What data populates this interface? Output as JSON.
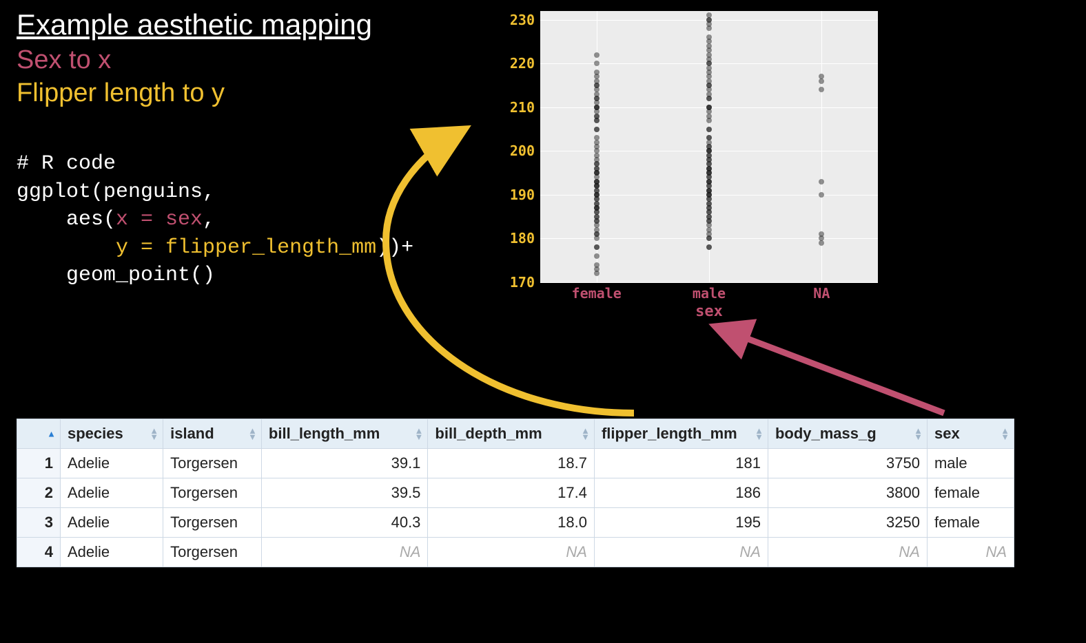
{
  "title": "Example aesthetic mapping",
  "subtitle1": "Sex to x",
  "subtitle2": "Flipper length to y",
  "code": {
    "l1": "# R code",
    "l2": "ggplot(penguins,",
    "l3a": "    aes(",
    "l3b": "x = sex",
    "l3c": ",",
    "l4a": "        ",
    "l4b": "y = flipper_length_mm",
    "l4c": "))+",
    "l5": "    geom_point()"
  },
  "table": {
    "headers": [
      "",
      "species",
      "island",
      "bill_length_mm",
      "bill_depth_mm",
      "flipper_length_mm",
      "body_mass_g",
      "sex"
    ],
    "rows": [
      {
        "idx": "1",
        "species": "Adelie",
        "island": "Torgersen",
        "bill_length_mm": "39.1",
        "bill_depth_mm": "18.7",
        "flipper_length_mm": "181",
        "body_mass_g": "3750",
        "sex": "male"
      },
      {
        "idx": "2",
        "species": "Adelie",
        "island": "Torgersen",
        "bill_length_mm": "39.5",
        "bill_depth_mm": "17.4",
        "flipper_length_mm": "186",
        "body_mass_g": "3800",
        "sex": "female"
      },
      {
        "idx": "3",
        "species": "Adelie",
        "island": "Torgersen",
        "bill_length_mm": "40.3",
        "bill_depth_mm": "18.0",
        "flipper_length_mm": "195",
        "body_mass_g": "3250",
        "sex": "female"
      },
      {
        "idx": "4",
        "species": "Adelie",
        "island": "Torgersen",
        "bill_length_mm": "NA",
        "bill_depth_mm": "NA",
        "flipper_length_mm": "NA",
        "body_mass_g": "NA",
        "sex": "NA"
      }
    ]
  },
  "chart_data": {
    "type": "scatter",
    "xlabel": "sex",
    "ylabel": "flipper_length_mm",
    "ylim": [
      170,
      232
    ],
    "yticks": [
      170,
      180,
      190,
      200,
      210,
      220,
      230
    ],
    "categories": [
      "female",
      "male",
      "NA"
    ],
    "series": [
      {
        "name": "female",
        "x": "female",
        "y": [
          172,
          173,
          174,
          176,
          178,
          178,
          180,
          181,
          181,
          182,
          183,
          184,
          184,
          185,
          185,
          186,
          186,
          187,
          187,
          187,
          188,
          188,
          189,
          189,
          190,
          190,
          190,
          191,
          191,
          192,
          192,
          192,
          193,
          193,
          193,
          194,
          195,
          195,
          195,
          196,
          196,
          197,
          197,
          198,
          199,
          200,
          201,
          202,
          203,
          205,
          205,
          207,
          207,
          208,
          208,
          209,
          210,
          210,
          210,
          211,
          212,
          212,
          213,
          214,
          215,
          215,
          216,
          217,
          218,
          220,
          222
        ]
      },
      {
        "name": "male",
        "x": "male",
        "y": [
          178,
          178,
          180,
          180,
          181,
          182,
          183,
          184,
          184,
          185,
          185,
          186,
          186,
          187,
          187,
          188,
          188,
          189,
          189,
          190,
          190,
          190,
          191,
          191,
          191,
          192,
          192,
          193,
          193,
          193,
          194,
          194,
          195,
          195,
          195,
          196,
          196,
          196,
          197,
          197,
          198,
          198,
          199,
          199,
          200,
          200,
          200,
          201,
          201,
          202,
          203,
          203,
          205,
          205,
          207,
          208,
          209,
          210,
          210,
          210,
          212,
          212,
          213,
          214,
          215,
          215,
          216,
          217,
          218,
          219,
          220,
          220,
          221,
          222,
          223,
          224,
          225,
          226,
          228,
          229,
          230,
          230,
          231
        ]
      },
      {
        "name": "NA",
        "x": "NA",
        "y": [
          179,
          180,
          181,
          190,
          193,
          214,
          216,
          217
        ]
      }
    ]
  }
}
